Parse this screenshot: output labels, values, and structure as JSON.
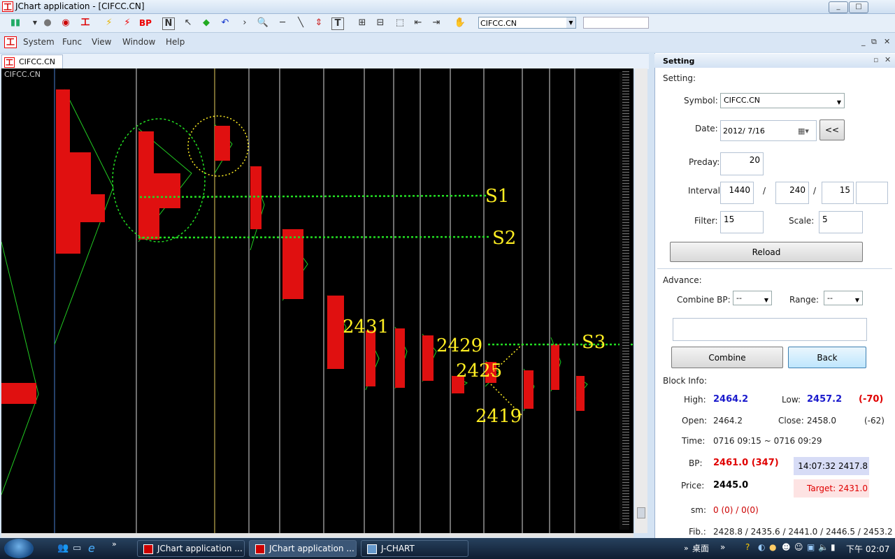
{
  "window": {
    "title": "JChart application - [CIFCC.CN]",
    "min": "_",
    "max": "□",
    "close": "✕"
  },
  "toolbar": {
    "symbol": "CIFCC.CN",
    "bp_label": "BP",
    "n_label": "N",
    "t_label": "T"
  },
  "menu": {
    "items": [
      "System",
      "Func",
      "View",
      "Window",
      "Help"
    ]
  },
  "chart": {
    "tab_label": "CIFCC.CN",
    "corner_label": "CIFCC.CN",
    "annotations": {
      "s1": "S1",
      "s2": "S2",
      "s3": "S3",
      "l2431": "2431",
      "l2429": "2429",
      "l2425": "2425",
      "l2419": "2419"
    }
  },
  "panel": {
    "title": "Setting",
    "setting_section": "Setting:",
    "symbol_label": "Symbol:",
    "symbol_value": "CIFCC.CN",
    "date_label": "Date:",
    "date_value": "2012/  7/16",
    "date_back": "<<",
    "preday_label": "Preday:",
    "preday_value": "20",
    "interval_label": "Interval:",
    "interval_1": "1440",
    "interval_sep1": "/",
    "interval_2": "240",
    "interval_sep2": "/",
    "interval_3": "15",
    "interval_4": "",
    "filter_label": "Filter:",
    "filter_value": "15",
    "scale_label": "Scale:",
    "scale_value": "5",
    "reload": "Reload",
    "advance_section": "Advance:",
    "combine_bp_label": "Combine BP:",
    "combine_bp_value": "--",
    "range_label": "Range:",
    "range_value": "--",
    "combine": "Combine",
    "back": "Back",
    "block_section": "Block Info:",
    "high_label": "High:",
    "high": "2464.2",
    "low_label": "Low:",
    "low": "2457.2",
    "low_diff": "(-70)",
    "open_label": "Open:",
    "open": "2464.2",
    "close_label": "Close:",
    "close": "2458.0",
    "close_diff": "(-62)",
    "time_label": "Time:",
    "time": "0716 09:15 ~ 0716 09:29",
    "bp_label": "BP:",
    "bp": "2461.0 (347)",
    "bp_time": "14:07:32  2417.8",
    "target": "Target: 2431.0",
    "price_label": "Price:",
    "price": "2445.0",
    "sm_label": "sm:",
    "sm": "0 (0) / 0(0)",
    "fib_label": "Fib.:",
    "fib": "2428.8 / 2435.6 / 2441.0 / 2446.5 / 2453.2"
  },
  "taskbar": {
    "tasks": [
      "JChart application ...",
      "JChart application ...",
      "J-CHART"
    ],
    "desktop": "桌面",
    "clock": "下午 02:07"
  },
  "colors": {
    "chart_bg": "#000000",
    "profile": "#e01010",
    "green": "#22cc22",
    "yellow": "#ffee22",
    "accent_red": "#e00000",
    "accent_blue": "#1a1acc"
  }
}
